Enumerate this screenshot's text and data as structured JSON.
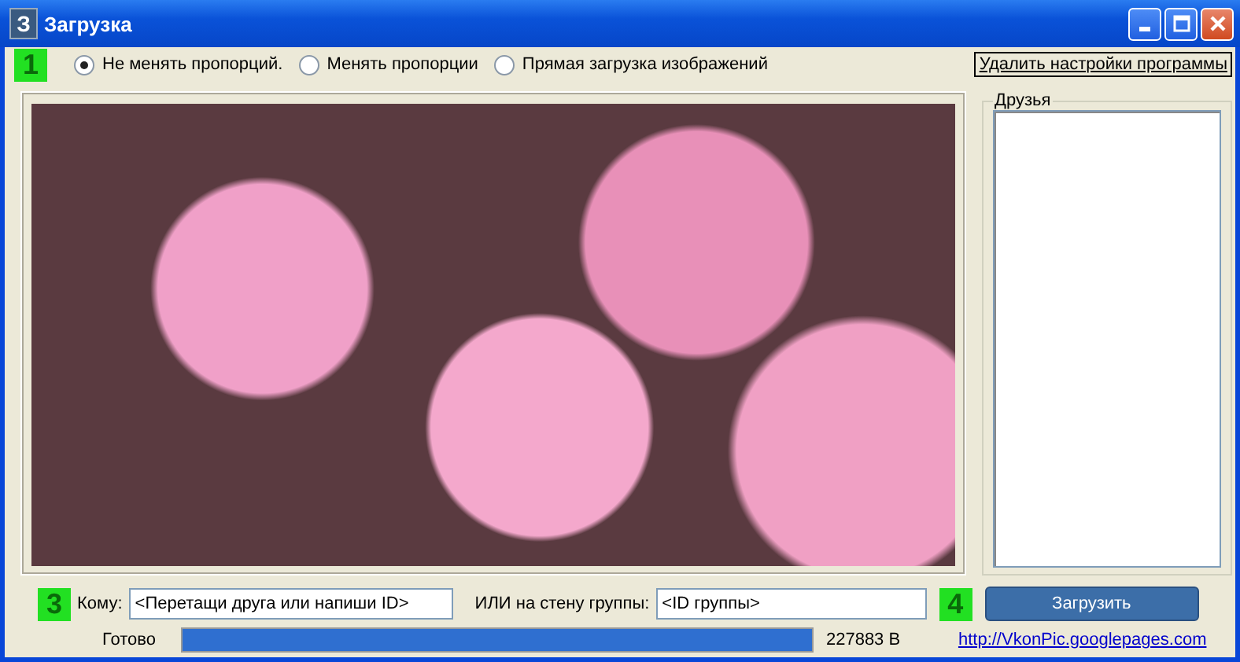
{
  "window": {
    "icon_text": "З",
    "title": "Загрузка"
  },
  "markers": [
    "1",
    "3",
    "4"
  ],
  "options": [
    {
      "label": "Не менять пропорций.",
      "selected": true
    },
    {
      "label": "Менять пропорции",
      "selected": false
    },
    {
      "label": "Прямая загрузка изображений",
      "selected": false
    }
  ],
  "reset_button": "Удалить настройки программы",
  "friends": {
    "title": "Друзья"
  },
  "recipient": {
    "label": "Кому:",
    "value": "<Перетащи друга или напиши ID>"
  },
  "group": {
    "label": "ИЛИ на стену группы:",
    "value": "<ID группы>"
  },
  "upload_button": "Загрузить",
  "status": {
    "text": "Готово",
    "level": 1,
    "size": "227883 B"
  },
  "link": "http://VkonPic.googlepages.com"
}
